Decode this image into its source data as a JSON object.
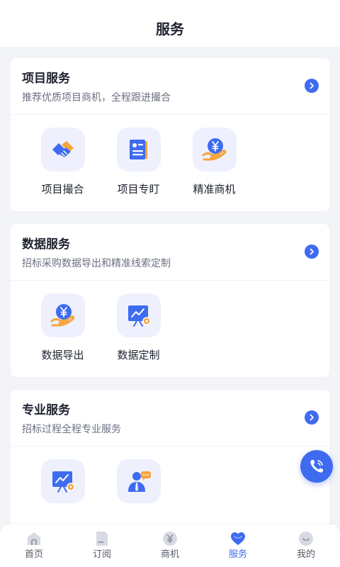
{
  "header": {
    "title": "服务"
  },
  "sections": [
    {
      "title": "项目服务",
      "subtitle": "推荐优质项目商机，全程跟进撮合",
      "items": [
        {
          "label": "项目撮合",
          "icon": "handshake-icon"
        },
        {
          "label": "项目专盯",
          "icon": "document-icon"
        },
        {
          "label": "精准商机",
          "icon": "yuan-hand-icon"
        }
      ]
    },
    {
      "title": "数据服务",
      "subtitle": "招标采购数据导出和精准线索定制",
      "items": [
        {
          "label": "数据导出",
          "icon": "yuan-hand-icon"
        },
        {
          "label": "数据定制",
          "icon": "chart-board-icon"
        }
      ]
    },
    {
      "title": "专业服务",
      "subtitle": "招标过程全程专业服务",
      "items": [
        {
          "label": "",
          "icon": "chart-board-icon"
        },
        {
          "label": "",
          "icon": "consultant-icon"
        }
      ]
    }
  ],
  "tabbar": {
    "items": [
      {
        "label": "首页",
        "icon": "home-icon"
      },
      {
        "label": "订阅",
        "icon": "subscribe-icon"
      },
      {
        "label": "商机",
        "icon": "yuan-coin-icon"
      },
      {
        "label": "服务",
        "icon": "heart-icon",
        "active": true
      },
      {
        "label": "我的",
        "icon": "profile-icon"
      }
    ]
  },
  "colors": {
    "accent": "#3f6bf0",
    "orange": "#f5a43c",
    "icon_bg": "#eef1fd",
    "page_bg": "#f3f4f7"
  }
}
